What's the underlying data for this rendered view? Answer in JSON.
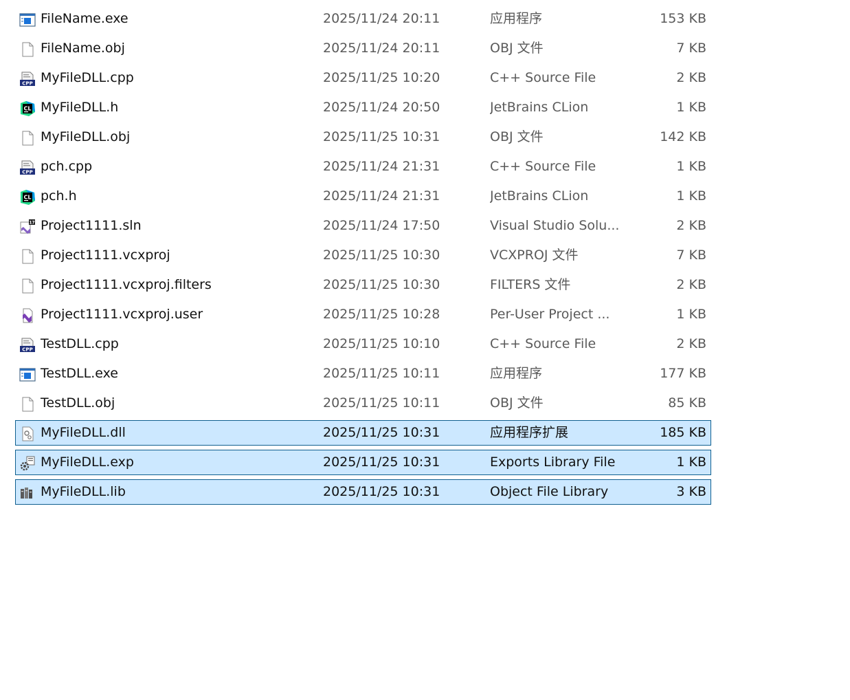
{
  "files": [
    {
      "icon": "exe-app-icon",
      "name": "FileName.exe",
      "date": "2025/11/24 20:11",
      "type": "应用程序",
      "size": "153 KB",
      "selected": false
    },
    {
      "icon": "blank-file-icon",
      "name": "FileName.obj",
      "date": "2025/11/24 20:11",
      "type": "OBJ 文件",
      "size": "7 KB",
      "selected": false
    },
    {
      "icon": "cpp-file-icon",
      "name": "MyFileDLL.cpp",
      "date": "2025/11/25 10:20",
      "type": "C++ Source File",
      "size": "2 KB",
      "selected": false
    },
    {
      "icon": "clion-icon",
      "name": "MyFileDLL.h",
      "date": "2025/11/24 20:50",
      "type": "JetBrains CLion",
      "size": "1 KB",
      "selected": false
    },
    {
      "icon": "blank-file-icon",
      "name": "MyFileDLL.obj",
      "date": "2025/11/25 10:31",
      "type": "OBJ 文件",
      "size": "142 KB",
      "selected": false
    },
    {
      "icon": "cpp-file-icon",
      "name": "pch.cpp",
      "date": "2025/11/24 21:31",
      "type": "C++ Source File",
      "size": "1 KB",
      "selected": false
    },
    {
      "icon": "clion-icon",
      "name": "pch.h",
      "date": "2025/11/24 21:31",
      "type": "JetBrains CLion",
      "size": "1 KB",
      "selected": false
    },
    {
      "icon": "visual-studio-solution-icon",
      "name": "Project1111.sln",
      "date": "2025/11/24 17:50",
      "type": "Visual Studio Solu...",
      "size": "2 KB",
      "selected": false
    },
    {
      "icon": "blank-file-icon",
      "name": "Project1111.vcxproj",
      "date": "2025/11/25 10:30",
      "type": "VCXPROJ 文件",
      "size": "7 KB",
      "selected": false
    },
    {
      "icon": "blank-file-icon",
      "name": "Project1111.vcxproj.filters",
      "date": "2025/11/25 10:30",
      "type": "FILTERS 文件",
      "size": "2 KB",
      "selected": false
    },
    {
      "icon": "visual-studio-file-icon",
      "name": "Project1111.vcxproj.user",
      "date": "2025/11/25 10:28",
      "type": "Per-User Project ...",
      "size": "1 KB",
      "selected": false
    },
    {
      "icon": "cpp-file-icon",
      "name": "TestDLL.cpp",
      "date": "2025/11/25 10:10",
      "type": "C++ Source File",
      "size": "2 KB",
      "selected": false
    },
    {
      "icon": "exe-app-icon",
      "name": "TestDLL.exe",
      "date": "2025/11/25 10:11",
      "type": "应用程序",
      "size": "177 KB",
      "selected": false
    },
    {
      "icon": "blank-file-icon",
      "name": "TestDLL.obj",
      "date": "2025/11/25 10:11",
      "type": "OBJ 文件",
      "size": "85 KB",
      "selected": false
    },
    {
      "icon": "dll-gear-file-icon",
      "name": "MyFileDLL.dll",
      "date": "2025/11/25 10:31",
      "type": "应用程序扩展",
      "size": "185 KB",
      "selected": true
    },
    {
      "icon": "exports-gear-icon",
      "name": "MyFileDLL.exp",
      "date": "2025/11/25 10:31",
      "type": "Exports Library File",
      "size": "1 KB",
      "selected": true
    },
    {
      "icon": "library-books-icon",
      "name": "MyFileDLL.lib",
      "date": "2025/11/25 10:31",
      "type": "Object File Library",
      "size": "3 KB",
      "selected": true
    }
  ],
  "colors": {
    "selection_background": "#cce8ff",
    "selection_border": "#0f5f8f",
    "secondary_text": "#5a5a5a"
  }
}
